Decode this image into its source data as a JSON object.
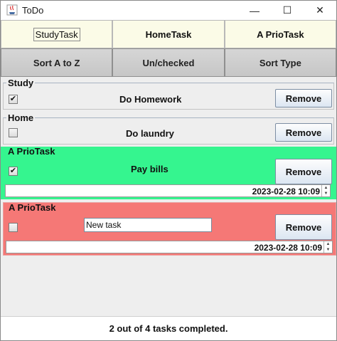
{
  "window": {
    "title": "ToDo",
    "minimize_glyph": "—",
    "maximize_glyph": "☐",
    "close_glyph": "✕"
  },
  "toolbar_top": [
    {
      "label": "StudyTask"
    },
    {
      "label": "HomeTask"
    },
    {
      "label": "A PrioTask"
    }
  ],
  "toolbar_sort": [
    {
      "label": "Sort A to Z"
    },
    {
      "label": "Un/checked"
    },
    {
      "label": "Sort Type"
    }
  ],
  "tasks": [
    {
      "group": "Study",
      "name": "Do Homework",
      "checked": true,
      "check_glyph": "✔",
      "remove_label": "Remove"
    },
    {
      "group": "Home",
      "name": "Do laundry",
      "checked": false,
      "check_glyph": "",
      "remove_label": "Remove"
    },
    {
      "group": "A PrioTask",
      "name": "Pay bills",
      "checked": true,
      "check_glyph": "✔",
      "remove_label": "Remove",
      "date": "2023-02-28 10:09",
      "background": "#35f58f"
    },
    {
      "group": "A PrioTask",
      "name_input_value": "New task",
      "checked": false,
      "check_glyph": "",
      "remove_label": "Remove",
      "date": "2023-02-28 10:09",
      "background": "#f57876"
    }
  ],
  "spinner": {
    "up": "▲",
    "down": "▼"
  },
  "status": {
    "text": "2 out of 4 tasks completed."
  }
}
